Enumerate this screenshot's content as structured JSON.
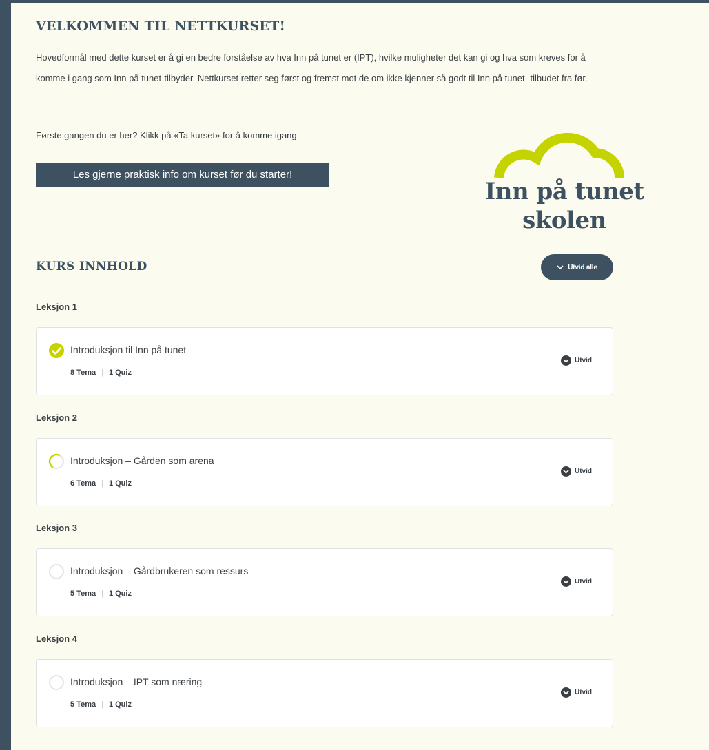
{
  "header": {
    "title": "VELKOMMEN TIL NETTKURSET!",
    "intro": "Hovedformål med dette kurset er å gi en bedre forståelse av hva Inn på tunet er (IPT), hvilke muligheter det kan gi og hva som kreves for å komme i gang som Inn på tunet-tilbyder. Nettkurset retter seg først og fremst mot de om ikke kjenner så godt til Inn på tunet- tilbudet fra før.",
    "first_time": "Første gangen du er her? Klikk på «Ta kurset» for å komme igang.",
    "info_button": "Les gjerne praktisk info om kurset før du starter!"
  },
  "logo": {
    "line1": "Inn på tunet",
    "line2": "skolen",
    "icon": "cloud-arc-logo"
  },
  "content": {
    "title": "KURS INNHOLD",
    "expand_all": "Utvid alle",
    "lessons": [
      {
        "label": "Leksjon 1",
        "title": "Introduksjon til Inn på tunet",
        "topics": "8 Tema",
        "quiz": "1 Quiz",
        "status": "complete",
        "expand": "Utvid"
      },
      {
        "label": "Leksjon 2",
        "title": "Introduksjon – Gården som arena",
        "topics": "6 Tema",
        "quiz": "1 Quiz",
        "status": "in-progress",
        "expand": "Utvid"
      },
      {
        "label": "Leksjon 3",
        "title": "Introduksjon – Gårdbrukeren som ressurs",
        "topics": "5 Tema",
        "quiz": "1 Quiz",
        "status": "not-started",
        "expand": "Utvid"
      },
      {
        "label": "Leksjon 4",
        "title": "Introduksjon – IPT som næring",
        "topics": "5 Tema",
        "quiz": "1 Quiz",
        "status": "not-started",
        "expand": "Utvid"
      }
    ]
  },
  "colors": {
    "accent": "#c5d300",
    "dark": "#3d5160",
    "background": "#fbfcef",
    "text": "#3a3f44"
  }
}
